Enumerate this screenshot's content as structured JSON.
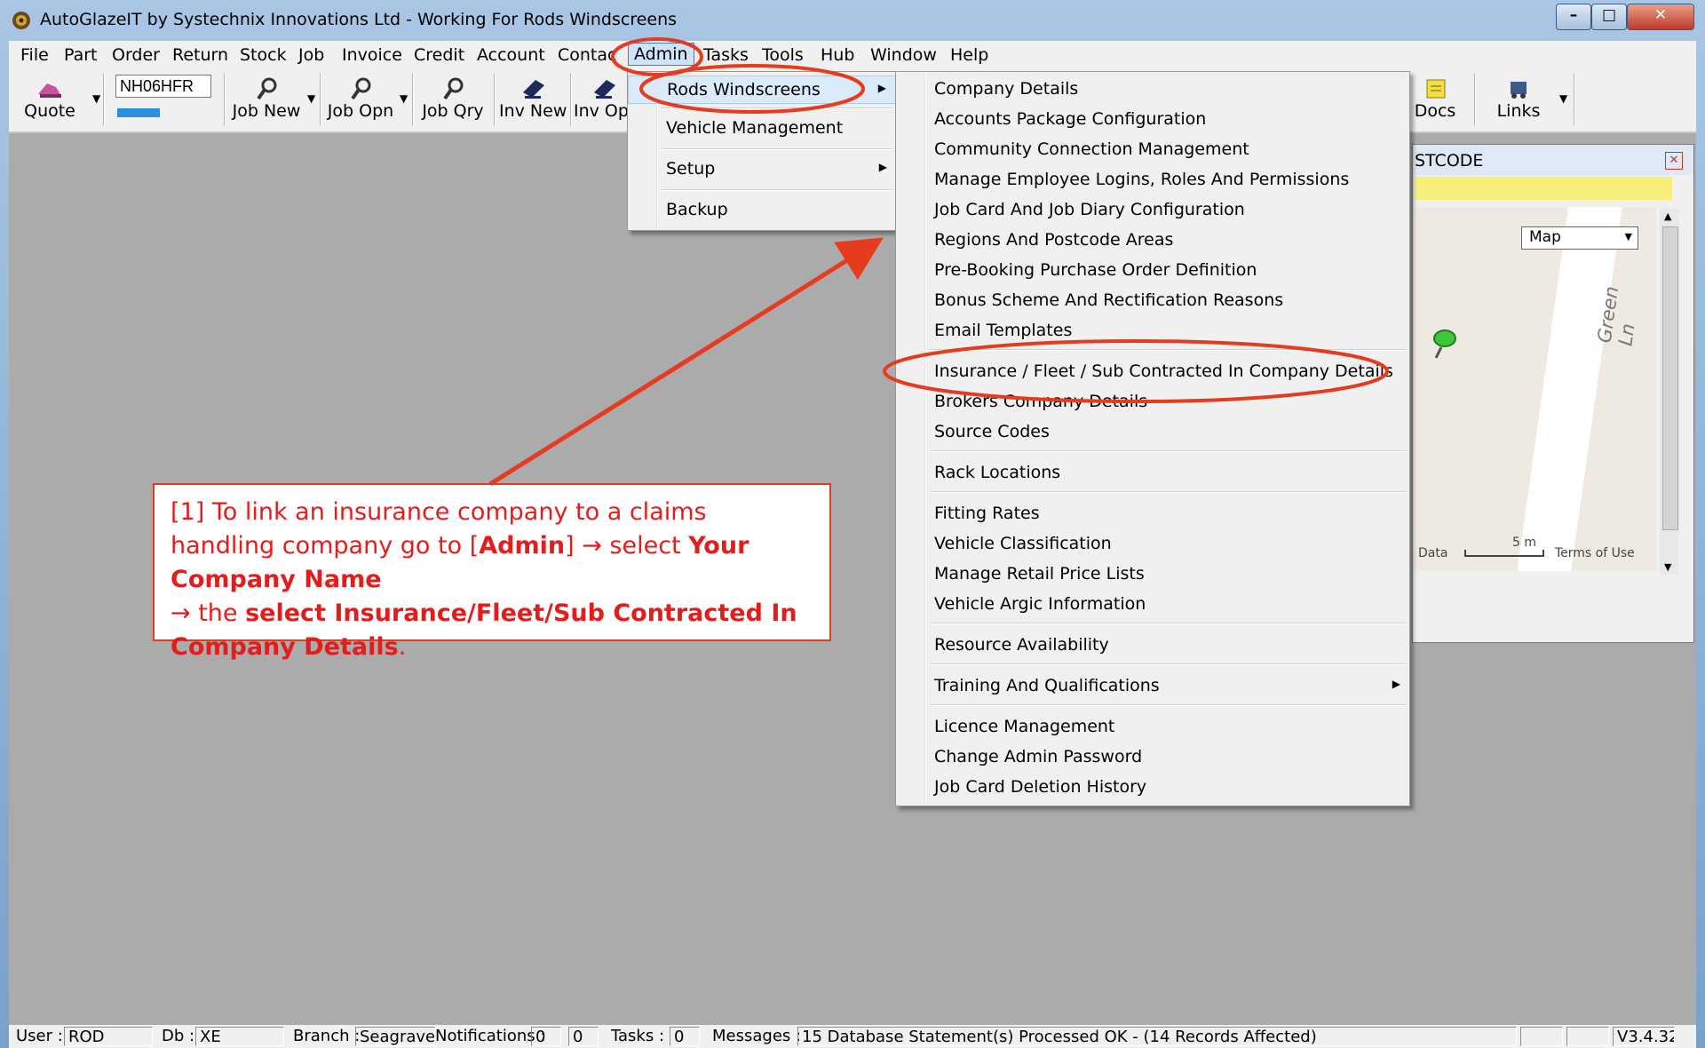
{
  "window": {
    "title": "AutoGlazeIT by Systechnix Innovations Ltd -  Working For Rods Windscreens"
  },
  "menubar": [
    "File",
    "Part",
    "Order",
    "Return",
    "Stock",
    "Job",
    "Invoice",
    "Credit",
    "Account",
    "Contac",
    "Admin",
    "Tasks",
    "Tools",
    "Hub",
    "Window",
    "Help"
  ],
  "toolbar": {
    "quote": "Quote",
    "reg_value": "NH06HFR",
    "job_new": "Job New",
    "job_opn": "Job Opn",
    "job_qry": "Job Qry",
    "inv_new": "Inv New",
    "inv_opn": "Inv Opn",
    "docs": "Docs",
    "links": "Links"
  },
  "admin_menu": {
    "items": [
      "Rods Windscreens",
      "Vehicle Management",
      "Setup",
      "Backup"
    ]
  },
  "company_menu": {
    "group1": [
      "Company Details",
      "Accounts Package Configuration",
      "Community Connection Management",
      "Manage Employee Logins, Roles And Permissions",
      "Job Card And Job Diary Configuration",
      "Regions And Postcode Areas",
      "Pre-Booking Purchase Order Definition",
      "Bonus Scheme And Rectification Reasons",
      "Email Templates"
    ],
    "group2": [
      "Insurance / Fleet / Sub Contracted In Company Details",
      "Brokers Company Details",
      "Source Codes"
    ],
    "group3": [
      "Rack Locations"
    ],
    "group4": [
      "Fitting Rates",
      "Vehicle Classification",
      "Manage Retail Price Lists",
      "Vehicle Argic Information"
    ],
    "group5": [
      "Resource Availability"
    ],
    "group6": [
      "Training And Qualifications"
    ],
    "group7": [
      "Licence Management",
      "Change Admin Password",
      "Job Card Deletion History"
    ]
  },
  "map_panel": {
    "title": "STCODE",
    "map_type": "Map",
    "street": "Green Ln",
    "scale": "5 m",
    "data": "Data",
    "terms": "Terms of Use"
  },
  "callout": {
    "p1": "[1] To link an insurance company to a claims handling company go to [",
    "admin": "Admin",
    "p2": "] → select ",
    "company": "Your Company Name",
    "p3": " → the ",
    "select": "select Insurance/Fleet/Sub Contracted In Company Details",
    "p4": "."
  },
  "statusbar": {
    "user_label": "User :",
    "user": "ROD",
    "db_label": "Db :",
    "db": "XE",
    "branch_label": "Branch :",
    "branch": "Seagrave",
    "notif_label": "Notifications :",
    "notif1": "0",
    "notif2": "0",
    "tasks_label": "Tasks :",
    "tasks": "0",
    "messages_label": "Messages :",
    "message": "15 Database Statement(s) Processed OK - (14 Records Affected)",
    "version": "V3.4.32"
  },
  "colors": {
    "accent_red": "#e53b1f",
    "highlight": "#dbeaf9",
    "map_bar": "#f6f07a"
  }
}
